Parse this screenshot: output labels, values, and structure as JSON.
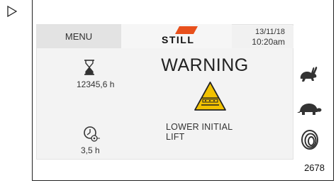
{
  "screen": {
    "menu_label": "MENU",
    "logo_text": "STILL",
    "date": "13/11/18",
    "time": "10:20am",
    "hours_total": "12345,6 h",
    "hours_trip": "3,5 h",
    "warning_title": "WARNING",
    "warning_message": "LOWER INITIAL LIFT"
  },
  "figure_number": "2678",
  "icons": [
    "play-arrow-icon",
    "still-logo-icon",
    "hourglass-icon",
    "clock-icon",
    "warning-triangle-icon",
    "hare-icon",
    "tortoise-icon",
    "spiral-icon"
  ],
  "colors": {
    "warning_yellow": "#f2c200",
    "logo_orange": "#e8501c"
  }
}
